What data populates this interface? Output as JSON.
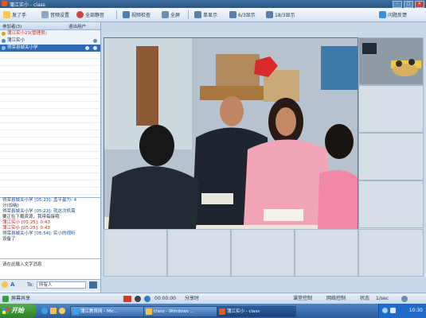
{
  "window": {
    "title": "蒲江实小 - class"
  },
  "toolbar": {
    "items": [
      {
        "label": "发了手"
      },
      {
        "label": "音频设置"
      },
      {
        "label": "全部静音"
      },
      {
        "label": "视频检查"
      },
      {
        "label": "全屏"
      },
      {
        "label": "单显示"
      },
      {
        "label": "6/3显示"
      },
      {
        "label": "18/3显示"
      },
      {
        "label": "问题反馈"
      }
    ]
  },
  "left_panel": {
    "header_left": "参加者(3)",
    "header_right": "退出用户",
    "participants": [
      {
        "name": "蒲江实小23(管理员)",
        "color": "#d0251a"
      },
      {
        "name": "蒲江实小",
        "color": "#1d2d44"
      },
      {
        "name": "得荣县城关小学",
        "color": "#ffffff",
        "selected": true
      }
    ]
  },
  "chat": {
    "messages": [
      "得荣县城关小学 [05:23]: 孟平基为: 4",
      "分(加纳)",
      "得荣县城关小学 [05:23]: 就这次机需",
      "要正在下载资源，我带每接哦",
      "蒲江实小 [05:25]: 0:43",
      "蒲江实小 [05:25]: 0:43",
      "得荣县城关小学 [05:54]: 实小的视听",
      "设备了"
    ],
    "input_placeholder": "请在此输入文字消息",
    "to_label": "To:",
    "to_value": "所有人"
  },
  "bottom": {
    "left": "屏幕共享",
    "time": "00:00:00",
    "share": "分享时",
    "control": "课堂控制",
    "network": "网络控制",
    "state": "状态",
    "speed": "1/sec"
  },
  "taskbar": {
    "start": "开始",
    "tasks": [
      {
        "label": "蒲江教育网 - Mic..."
      },
      {
        "label": "class - Windows ..."
      },
      {
        "label": "蒲江实小 - class"
      }
    ],
    "clock": "10:30"
  }
}
